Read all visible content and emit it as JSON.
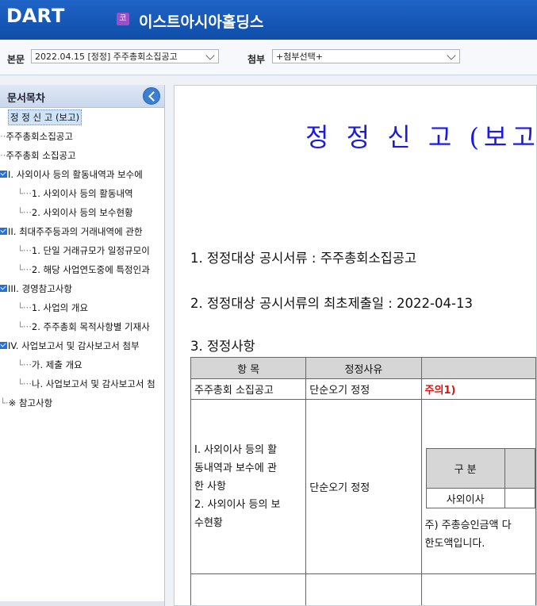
{
  "header": {
    "logo_text": "DART",
    "corp_badge": "코",
    "corp_name": "이스트아시아홀딩스"
  },
  "options": {
    "body_label": "본문",
    "body_select": "2022.04.15  [정정] 주주총회소집공고",
    "attach_label": "첨부",
    "attach_select": "+첨부선택+"
  },
  "toc": {
    "title": "문서목차",
    "items": [
      "정 정 신 고 (보고)",
      "주주총회소집공고",
      "주주총회 소집공고",
      "I. 사외이사 등의 활동내역과 보수에",
      "1. 사외이사 등의 활동내역",
      "2. 사외이사 등의 보수현황",
      "II. 최대주주등과의 거래내역에 관한",
      "1. 단일 거래규모가 일정규모이",
      "2. 해당 사업연도중에 특정인과",
      "III. 경영참고사항",
      "1. 사업의 개요",
      "2. 주주총회 목적사항별 기재사",
      "IV. 사업보고서 및 감사보고서 첨부",
      "가. 제출 개요",
      "나. 사업보고서 및 감사보고서 첨",
      "※ 참고사항"
    ]
  },
  "doc": {
    "title": "정 정 신 고 (보고",
    "line1": "1. 정정대상 공시서류 : 주주총회소집공고",
    "line2": "2. 정정대상 공시서류의 최초제출일 : 2022-04-13",
    "line3": "3. 정정사항",
    "table": {
      "headers": [
        "항  목",
        "정정사유",
        ""
      ],
      "row1": [
        "주주총회 소집공고",
        "단순오기 정정",
        "주의1)"
      ],
      "row2_item_lines": [
        "I. 사외이사 등의 활",
        "동내역과 보수에 관",
        "한 사항",
        "2. 사외이사 등의 보",
        "수현황"
      ],
      "row2_reason": "단순오기 정정",
      "inner_header": "구 분",
      "inner_row": "사외이사",
      "note_line1": "주) 주총승인금액 다",
      "note_line2": "한도액입니다."
    }
  }
}
